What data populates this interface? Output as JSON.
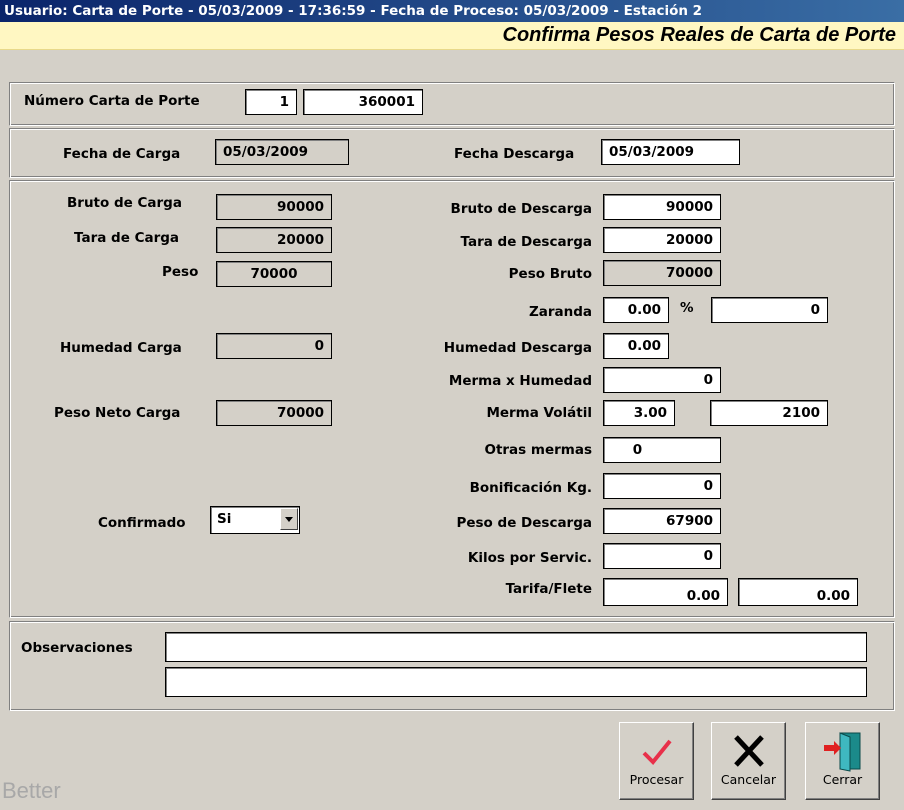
{
  "window": {
    "title": "Usuario: Carta de Porte - 05/03/2009 - 17:36:59 - Fecha de Proceso: 05/03/2009 - Estación 2",
    "subtitle": "Confirma Pesos Reales de Carta de Porte"
  },
  "carta": {
    "label": "Número Carta de Porte",
    "prefix": "1",
    "numero": "360001"
  },
  "fechas": {
    "carga_label": "Fecha de Carga",
    "carga": "05/03/2009",
    "descarga_label": "Fecha Descarga",
    "descarga": "05/03/2009"
  },
  "carga": {
    "bruto_label": "Bruto de Carga",
    "bruto": "90000",
    "tara_label": "Tara de Carga",
    "tara": "20000",
    "peso_label": "Peso",
    "peso": "70000",
    "humedad_label": "Humedad Carga",
    "humedad": "0",
    "neto_label": "Peso Neto Carga",
    "neto": "70000",
    "confirmado_label": "Confirmado",
    "confirmado": "Si"
  },
  "descarga": {
    "bruto_label": "Bruto de Descarga",
    "bruto": "90000",
    "tara_label": "Tara de Descarga",
    "tara": "20000",
    "peso_bruto_label": "Peso Bruto",
    "peso_bruto": "70000",
    "zaranda_label": "Zaranda",
    "zaranda_pct": "0.00",
    "pct_symbol": "%",
    "zaranda_kg": "0",
    "humedad_label": "Humedad Descarga",
    "humedad": "0.00",
    "merma_humedad_label": "Merma x Humedad",
    "merma_humedad": "0",
    "merma_volatil_label": "Merma Volátil",
    "merma_volatil_pct": "3.00",
    "merma_volatil_kg": "2100",
    "otras_label": "Otras mermas",
    "otras": "0",
    "bonificacion_label": "Bonificación Kg.",
    "bonificacion": "0",
    "peso_descarga_label": "Peso de Descarga",
    "peso_descarga": "67900",
    "kilos_servic_label": "Kilos por Servic.",
    "kilos_servic": "0",
    "tarifa_label": "Tarifa/Flete",
    "tarifa": "0.00",
    "flete": "0.00"
  },
  "observaciones": {
    "label": "Observaciones",
    "line1": "",
    "line2": ""
  },
  "buttons": {
    "procesar": "Procesar",
    "cancelar": "Cancelar",
    "cerrar": "Cerrar"
  },
  "footer": {
    "watermark": "Better"
  },
  "colors": {
    "titlebar_start": "#0a246a",
    "titlebar_end": "#3a6ea5",
    "subtitle_bg": "#fff7c2",
    "form_bg": "#d4d0c8",
    "check_red": "#e8304a"
  }
}
